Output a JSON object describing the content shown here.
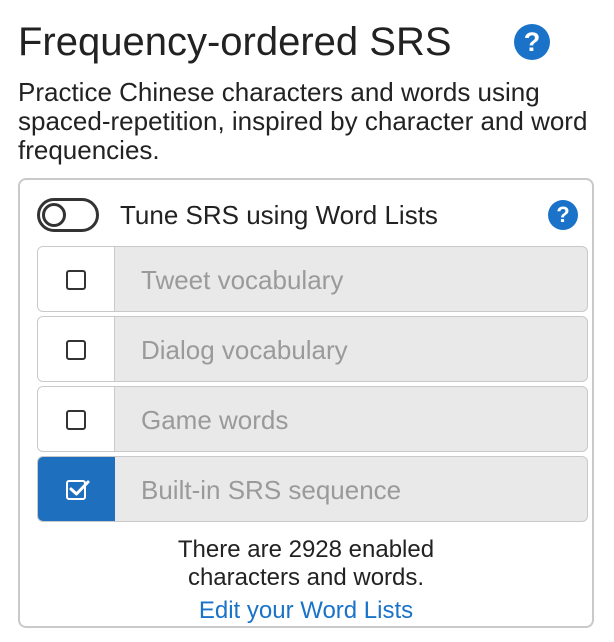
{
  "header": {
    "title": "Frequency-ordered SRS",
    "help_icon": "?"
  },
  "description": "Practice Chinese characters and words using spaced-repetition, inspired by character and word frequencies.",
  "tune": {
    "label": "Tune SRS using Word Lists",
    "enabled": false,
    "help_icon": "?"
  },
  "word_lists": [
    {
      "label": "Tweet vocabulary",
      "checked": false
    },
    {
      "label": "Dialog vocabulary",
      "checked": false
    },
    {
      "label": "Game words",
      "checked": false
    },
    {
      "label": "Built-in SRS sequence",
      "checked": true
    }
  ],
  "summary": {
    "line1": "There are 2928 enabled",
    "line2": "characters and words."
  },
  "edit_link": "Edit your Word Lists",
  "colors": {
    "accent": "#1a73c8",
    "checked_bg": "#1f6fbf",
    "disabled_text": "#9a9a9a"
  }
}
